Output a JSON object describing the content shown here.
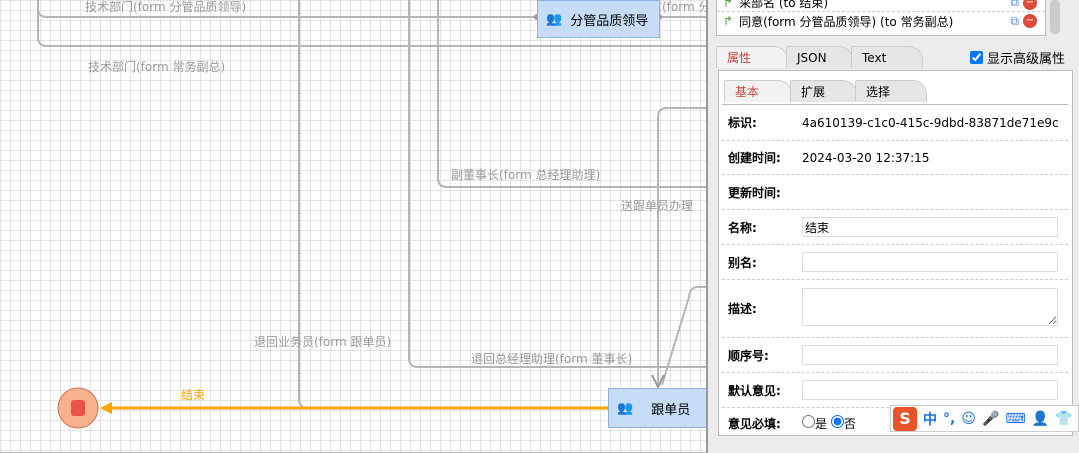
{
  "canvas": {
    "labels": [
      "技术部门(form 分管品质领导)",
      "技术部门(form 常务副总)",
      "同意(form 分",
      "副董事长(form 总经理助理)",
      "送跟单员办理",
      "退回业务员(form 跟单员)",
      "退回总经理助理(form 董事长)"
    ],
    "end_label": "结束",
    "nodes": {
      "quality_leader": "分管品质领导",
      "follower": "跟单员"
    },
    "colors": {
      "active_edge": "#ffa500",
      "edge": "#b5b5b5",
      "node_fill": "#c6dcf7",
      "end_fill": "#f8b08e",
      "end_stop": "#e8534a"
    }
  },
  "panel": {
    "transitions": [
      {
        "label": "采部名 (to 结束)"
      },
      {
        "label": "同意(form 分管品质领导) (to 常务副总)"
      }
    ],
    "tabs": [
      "属性",
      "JSON",
      "Text"
    ],
    "active_tab": "属性",
    "show_advanced": {
      "label": "显示高级属性",
      "checked": true
    },
    "subtabs": [
      "基本",
      "扩展",
      "选择"
    ],
    "active_subtab": "基本",
    "fields": {
      "id": {
        "label": "标识:",
        "value": "4a610139-c1c0-415c-9dbd-83871de71e9c"
      },
      "created": {
        "label": "创建时间:",
        "value": "2024-03-20 12:37:15"
      },
      "updated": {
        "label": "更新时间:",
        "value": ""
      },
      "name": {
        "label": "名称:",
        "value": "结束"
      },
      "alias": {
        "label": "别名:",
        "value": ""
      },
      "desc": {
        "label": "描述:",
        "value": ""
      },
      "order": {
        "label": "顺序号:",
        "value": ""
      },
      "default_opinion": {
        "label": "默认意见:",
        "value": ""
      },
      "opinion_required": {
        "label": "意见必填:",
        "options": [
          "是",
          "否"
        ],
        "selected": "否"
      }
    }
  },
  "ime": {
    "logo": "S",
    "mode": "中",
    "punct": "°,"
  }
}
